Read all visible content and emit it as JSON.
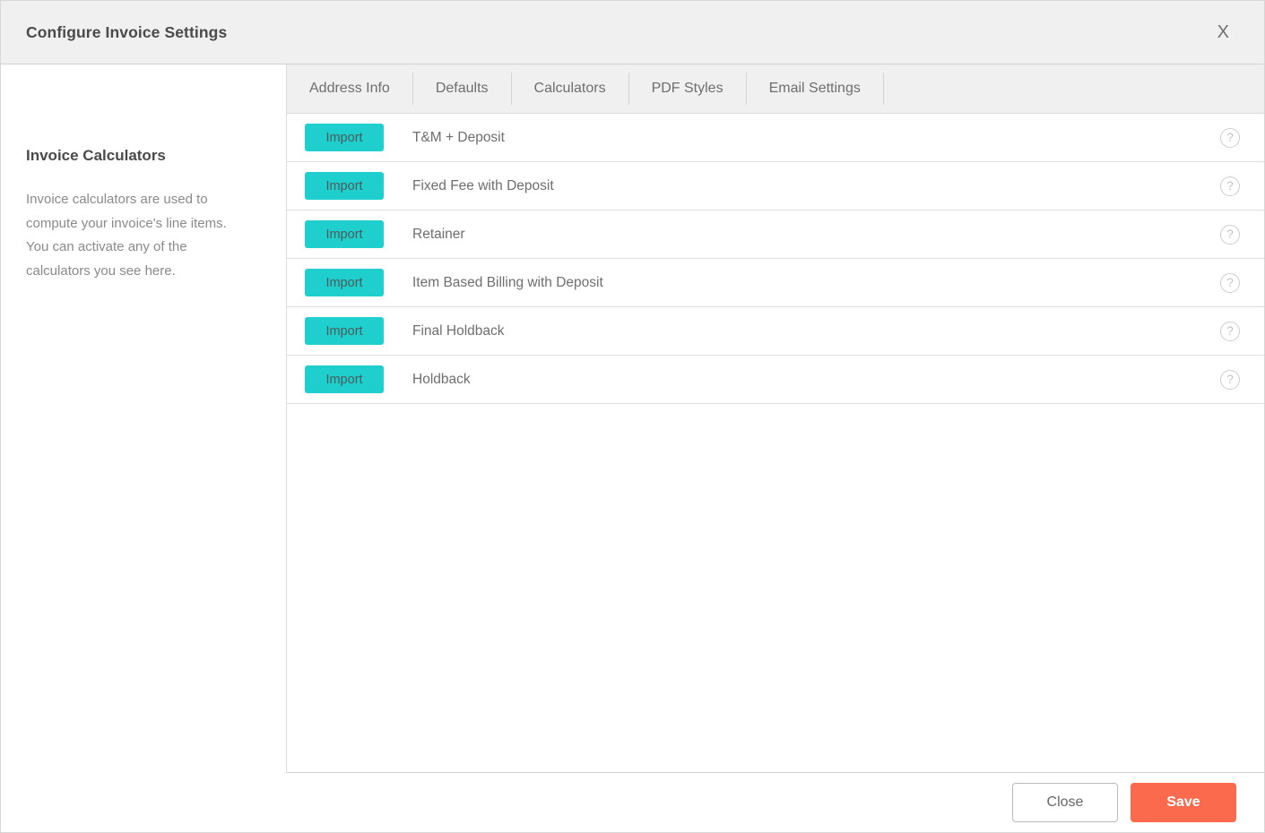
{
  "dialog": {
    "title": "Configure Invoice Settings",
    "close_icon": "close-x-icon",
    "close_label": "X"
  },
  "info_panel": {
    "title": "Invoice Calculators",
    "description": "Invoice calculators are used to compute your invoice's line items. You can activate any of the calculators you see here."
  },
  "tabs": [
    {
      "label": "Address Info",
      "active": false
    },
    {
      "label": "Defaults",
      "active": false
    },
    {
      "label": "Calculators",
      "active": true
    },
    {
      "label": "PDF Styles",
      "active": false
    },
    {
      "label": "Email Settings",
      "active": false
    }
  ],
  "calculators": [
    {
      "action_label": "Import",
      "name": "T&M + Deposit",
      "help_icon": "question-mark-icon",
      "help_label": "?"
    },
    {
      "action_label": "Import",
      "name": "Fixed Fee with Deposit",
      "help_icon": "question-mark-icon",
      "help_label": "?"
    },
    {
      "action_label": "Import",
      "name": "Retainer",
      "help_icon": "question-mark-icon",
      "help_label": "?"
    },
    {
      "action_label": "Import",
      "name": "Item Based Billing with Deposit",
      "help_icon": "question-mark-icon",
      "help_label": "?"
    },
    {
      "action_label": "Import",
      "name": "Final Holdback",
      "help_icon": "question-mark-icon",
      "help_label": "?"
    },
    {
      "action_label": "Import",
      "name": "Holdback",
      "help_icon": "question-mark-icon",
      "help_label": "?"
    }
  ],
  "footer": {
    "close_label": "Close",
    "save_label": "Save"
  },
  "colors": {
    "import_button": "#1fcfce",
    "save_button": "#fb6a4d",
    "header_background": "#f0f0f0",
    "tabbar_background": "#f0f0f0",
    "text_muted": "#6e6e6e"
  }
}
